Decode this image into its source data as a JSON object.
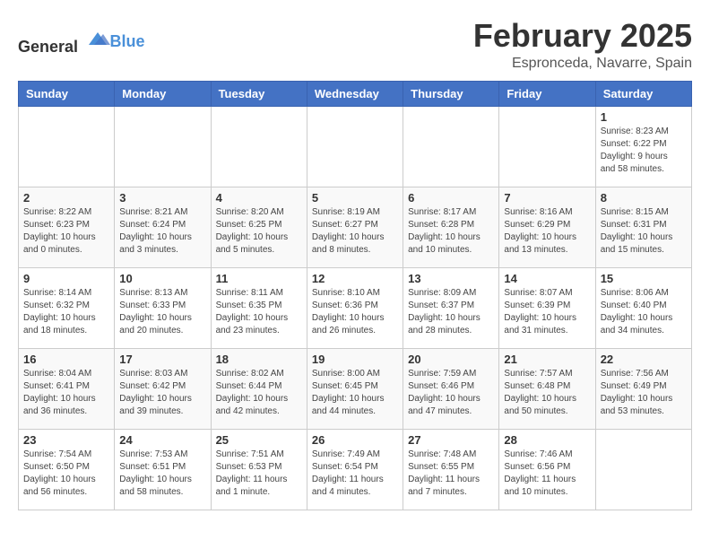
{
  "logo": {
    "text_general": "General",
    "text_blue": "Blue"
  },
  "title": {
    "month": "February 2025",
    "location": "Espronceda, Navarre, Spain"
  },
  "headers": [
    "Sunday",
    "Monday",
    "Tuesday",
    "Wednesday",
    "Thursday",
    "Friday",
    "Saturday"
  ],
  "weeks": [
    [
      {
        "day": "",
        "info": ""
      },
      {
        "day": "",
        "info": ""
      },
      {
        "day": "",
        "info": ""
      },
      {
        "day": "",
        "info": ""
      },
      {
        "day": "",
        "info": ""
      },
      {
        "day": "",
        "info": ""
      },
      {
        "day": "1",
        "info": "Sunrise: 8:23 AM\nSunset: 6:22 PM\nDaylight: 9 hours\nand 58 minutes."
      }
    ],
    [
      {
        "day": "2",
        "info": "Sunrise: 8:22 AM\nSunset: 6:23 PM\nDaylight: 10 hours\nand 0 minutes."
      },
      {
        "day": "3",
        "info": "Sunrise: 8:21 AM\nSunset: 6:24 PM\nDaylight: 10 hours\nand 3 minutes."
      },
      {
        "day": "4",
        "info": "Sunrise: 8:20 AM\nSunset: 6:25 PM\nDaylight: 10 hours\nand 5 minutes."
      },
      {
        "day": "5",
        "info": "Sunrise: 8:19 AM\nSunset: 6:27 PM\nDaylight: 10 hours\nand 8 minutes."
      },
      {
        "day": "6",
        "info": "Sunrise: 8:17 AM\nSunset: 6:28 PM\nDaylight: 10 hours\nand 10 minutes."
      },
      {
        "day": "7",
        "info": "Sunrise: 8:16 AM\nSunset: 6:29 PM\nDaylight: 10 hours\nand 13 minutes."
      },
      {
        "day": "8",
        "info": "Sunrise: 8:15 AM\nSunset: 6:31 PM\nDaylight: 10 hours\nand 15 minutes."
      }
    ],
    [
      {
        "day": "9",
        "info": "Sunrise: 8:14 AM\nSunset: 6:32 PM\nDaylight: 10 hours\nand 18 minutes."
      },
      {
        "day": "10",
        "info": "Sunrise: 8:13 AM\nSunset: 6:33 PM\nDaylight: 10 hours\nand 20 minutes."
      },
      {
        "day": "11",
        "info": "Sunrise: 8:11 AM\nSunset: 6:35 PM\nDaylight: 10 hours\nand 23 minutes."
      },
      {
        "day": "12",
        "info": "Sunrise: 8:10 AM\nSunset: 6:36 PM\nDaylight: 10 hours\nand 26 minutes."
      },
      {
        "day": "13",
        "info": "Sunrise: 8:09 AM\nSunset: 6:37 PM\nDaylight: 10 hours\nand 28 minutes."
      },
      {
        "day": "14",
        "info": "Sunrise: 8:07 AM\nSunset: 6:39 PM\nDaylight: 10 hours\nand 31 minutes."
      },
      {
        "day": "15",
        "info": "Sunrise: 8:06 AM\nSunset: 6:40 PM\nDaylight: 10 hours\nand 34 minutes."
      }
    ],
    [
      {
        "day": "16",
        "info": "Sunrise: 8:04 AM\nSunset: 6:41 PM\nDaylight: 10 hours\nand 36 minutes."
      },
      {
        "day": "17",
        "info": "Sunrise: 8:03 AM\nSunset: 6:42 PM\nDaylight: 10 hours\nand 39 minutes."
      },
      {
        "day": "18",
        "info": "Sunrise: 8:02 AM\nSunset: 6:44 PM\nDaylight: 10 hours\nand 42 minutes."
      },
      {
        "day": "19",
        "info": "Sunrise: 8:00 AM\nSunset: 6:45 PM\nDaylight: 10 hours\nand 44 minutes."
      },
      {
        "day": "20",
        "info": "Sunrise: 7:59 AM\nSunset: 6:46 PM\nDaylight: 10 hours\nand 47 minutes."
      },
      {
        "day": "21",
        "info": "Sunrise: 7:57 AM\nSunset: 6:48 PM\nDaylight: 10 hours\nand 50 minutes."
      },
      {
        "day": "22",
        "info": "Sunrise: 7:56 AM\nSunset: 6:49 PM\nDaylight: 10 hours\nand 53 minutes."
      }
    ],
    [
      {
        "day": "23",
        "info": "Sunrise: 7:54 AM\nSunset: 6:50 PM\nDaylight: 10 hours\nand 56 minutes."
      },
      {
        "day": "24",
        "info": "Sunrise: 7:53 AM\nSunset: 6:51 PM\nDaylight: 10 hours\nand 58 minutes."
      },
      {
        "day": "25",
        "info": "Sunrise: 7:51 AM\nSunset: 6:53 PM\nDaylight: 11 hours\nand 1 minute."
      },
      {
        "day": "26",
        "info": "Sunrise: 7:49 AM\nSunset: 6:54 PM\nDaylight: 11 hours\nand 4 minutes."
      },
      {
        "day": "27",
        "info": "Sunrise: 7:48 AM\nSunset: 6:55 PM\nDaylight: 11 hours\nand 7 minutes."
      },
      {
        "day": "28",
        "info": "Sunrise: 7:46 AM\nSunset: 6:56 PM\nDaylight: 11 hours\nand 10 minutes."
      },
      {
        "day": "",
        "info": ""
      }
    ]
  ]
}
